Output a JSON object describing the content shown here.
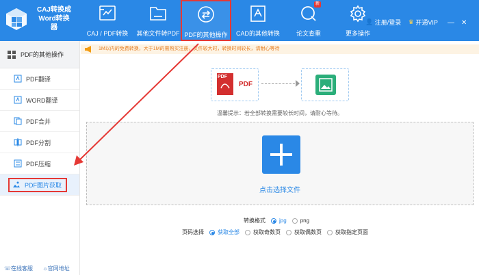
{
  "app": {
    "title_line1": "CAJ转换成",
    "title_line2": "Word转换",
    "title_line3": "器"
  },
  "nav": [
    {
      "label": "CAJ / PDF转换",
      "icon": "convert-icon"
    },
    {
      "label": "其他文件转PDF",
      "icon": "folder-icon"
    },
    {
      "label": "PDF的其他操作",
      "icon": "swap-icon",
      "active": true
    },
    {
      "label": "CAD的其他转换",
      "icon": "cad-icon"
    },
    {
      "label": "论文查重",
      "icon": "search-icon",
      "badge": "新"
    },
    {
      "label": "更多操作",
      "icon": "gear-icon"
    }
  ],
  "user": {
    "login": "注册/登录",
    "vip": "开通VIP"
  },
  "sidebar": {
    "header": "PDF的其他操作",
    "items": [
      {
        "label": "PDF翻译"
      },
      {
        "label": "WORD翻译"
      },
      {
        "label": "PDF合并"
      },
      {
        "label": "PDF分割"
      },
      {
        "label": "PDF压缩"
      },
      {
        "label": "PDF图片获取",
        "active": true
      }
    ],
    "footer": {
      "service": "在线客服",
      "website": "官网地址"
    }
  },
  "main": {
    "notice": "1M以内的免费转换，大于1M的需购买注册，文件较大时，转换时间较长，请耐心等待",
    "pdf_label": "PDF",
    "pdf_tag": "PDF",
    "tip": "温馨提示：若全部转换需要较长时间，请耐心等待。",
    "drop_label": "点击选择文件",
    "format_label": "转换格式",
    "formats": [
      "jpg",
      "png"
    ],
    "page_label": "页码选择",
    "page_options": [
      "获取全部",
      "获取奇数页",
      "获取偶数页",
      "获取指定页面"
    ]
  },
  "colors": {
    "primary": "#2a88e6",
    "highlight": "#e53935",
    "notice": "#e67e22"
  }
}
